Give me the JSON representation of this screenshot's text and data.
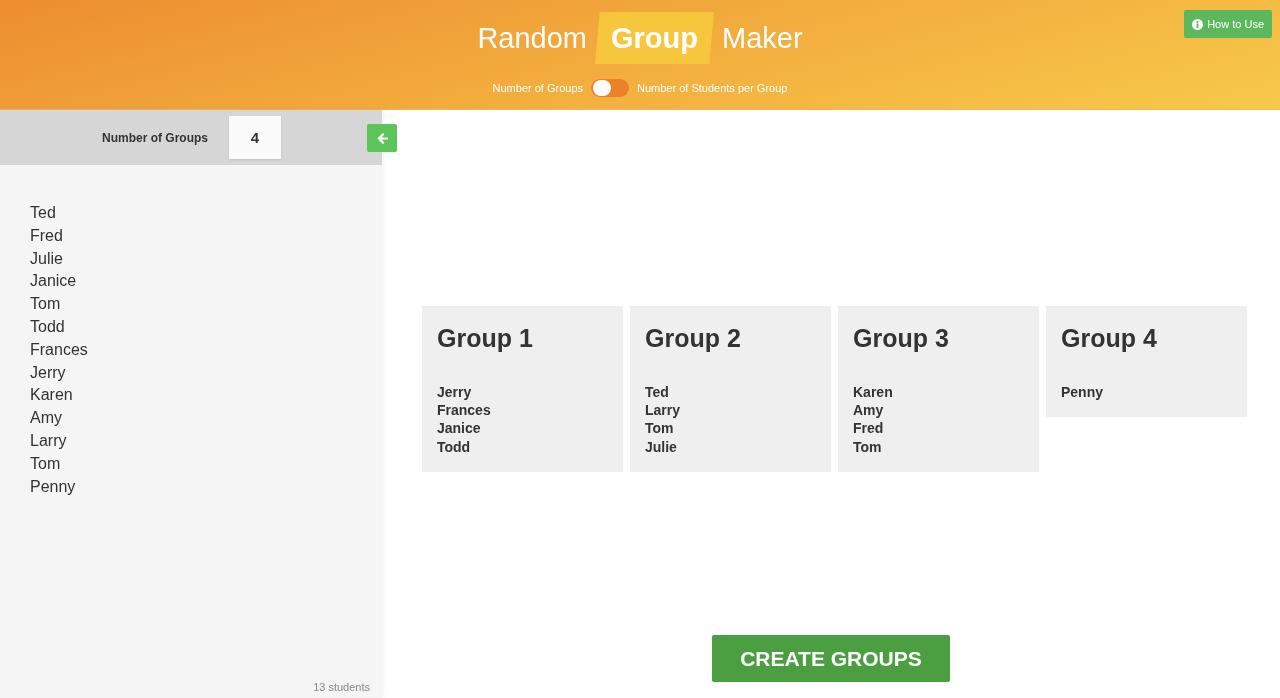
{
  "header": {
    "title": [
      {
        "text": "Random",
        "highlighted": false
      },
      {
        "text": "Group",
        "highlighted": true
      },
      {
        "text": "Maker",
        "highlighted": false
      }
    ],
    "mode_toggle": {
      "left_label": "Number of Groups",
      "right_label": "Number of Students per Group",
      "on": false
    },
    "help_button": {
      "label": "How to Use"
    }
  },
  "sidebar": {
    "groups_field": {
      "label": "Number of Groups",
      "value": "4"
    },
    "students": [
      "Ted",
      "Fred",
      "Julie",
      "Janice",
      "Tom",
      "Todd",
      "Frances",
      "Jerry",
      "Karen",
      "Amy",
      "Larry",
      "Tom",
      "Penny"
    ],
    "count": "13 students"
  },
  "groups": [
    {
      "title": "Group 1",
      "members": [
        "Jerry",
        "Frances",
        "Janice",
        "Todd"
      ]
    },
    {
      "title": "Group 2",
      "members": [
        "Ted",
        "Larry",
        "Tom",
        "Julie"
      ]
    },
    {
      "title": "Group 3",
      "members": [
        "Karen",
        "Amy",
        "Fred",
        "Tom"
      ]
    },
    {
      "title": "Group 4",
      "members": [
        "Penny"
      ]
    }
  ],
  "create_button": {
    "label": "CREATE GROUPS"
  }
}
